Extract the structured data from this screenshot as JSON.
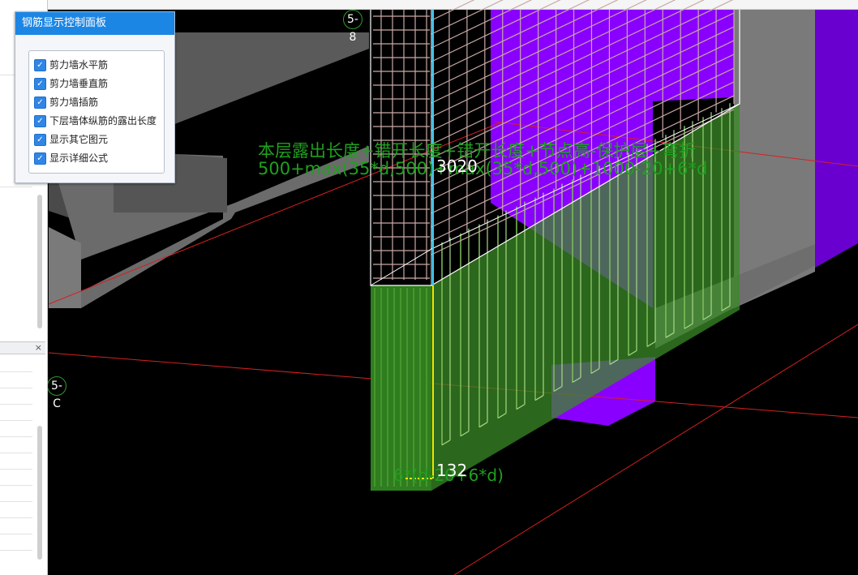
{
  "panel": {
    "title": "钢筋显示控制面板",
    "options": [
      {
        "label": "剪力墙水平筋",
        "checked": true
      },
      {
        "label": "剪力墙垂直筋",
        "checked": true
      },
      {
        "label": "剪力墙插筋",
        "checked": true
      },
      {
        "label": "下层墙体纵筋的露出长度",
        "checked": true
      },
      {
        "label": "显示其它图元",
        "checked": true
      },
      {
        "label": "显示详细公式",
        "checked": true
      }
    ]
  },
  "viewport": {
    "axis_labels": {
      "top": "5-8",
      "left": "5-C"
    },
    "formula_line1": "本层露出长度+错开长度+错开长度+节点高-保护层+弯折",
    "formula_line2": "500+max(35*d,500)+max(35*d,500)+1000-20+6*d",
    "dimension_upper": "3020",
    "dimension_lower": "132",
    "formula_lower": "6*(d-20+6*d)"
  },
  "left_panel": {
    "close_label": "×"
  },
  "colors": {
    "background": "#000000",
    "wall_purple": "#8a00ff",
    "insert_green": "#2e7d1e",
    "formula_green": "#1fa01f",
    "panel_title_blue": "#1c86e4"
  }
}
